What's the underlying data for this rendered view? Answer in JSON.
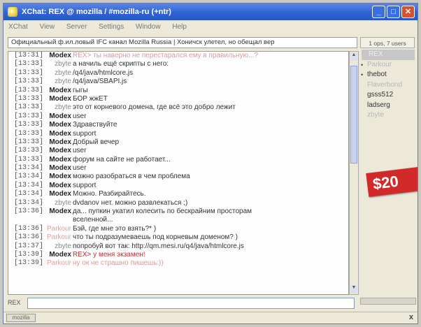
{
  "window": {
    "title": "XChat: REX @ mozilla / #mozilla-ru (+ntr)",
    "menu": [
      "XChat",
      "View",
      "Server",
      "Settings",
      "Window",
      "Help"
    ]
  },
  "channel_topic": "Официальный ф.ил.ловый IFC канал Mozilla Russia | Хоничск улетел, но обещал вер",
  "messages": [
    {
      "time": "[13:31]",
      "nick": "Modex",
      "text": "REX> ты наверно не перестарался ему в правильную...?",
      "style": "modex",
      "msg_style": "faded"
    },
    {
      "time": "[13:33]",
      "nick": "zbyte",
      "text": "а начиль ещё скрипты с него:",
      "style": "",
      "msg_style": ""
    },
    {
      "time": "[13:33]",
      "nick": "zbyte",
      "text": "/q4/java/htmlcore.js",
      "style": "",
      "msg_style": ""
    },
    {
      "time": "[13:33]",
      "nick": "zbyte",
      "text": "/q4/java/SBAPI.js",
      "style": "",
      "msg_style": ""
    },
    {
      "time": "[13:33]",
      "nick": "Modex",
      "text": "гыгы",
      "style": "modex",
      "msg_style": ""
    },
    {
      "time": "[13:33]",
      "nick": "Modex",
      "text": "БОР жжЕТ",
      "style": "modex",
      "msg_style": ""
    },
    {
      "time": "[13:33]",
      "nick": "zbyte",
      "text": "это от корневого домена, где всё это добро лежит",
      "style": "",
      "msg_style": ""
    },
    {
      "time": "[13:33]",
      "nick": "Modex",
      "text": "user",
      "style": "modex",
      "msg_style": ""
    },
    {
      "time": "[13:33]",
      "nick": "Modex",
      "text": "Здравствуйте",
      "style": "modex",
      "msg_style": ""
    },
    {
      "time": "[13:33]",
      "nick": "Modex",
      "text": "support",
      "style": "modex",
      "msg_style": ""
    },
    {
      "time": "[13:33]",
      "nick": "Modex",
      "text": "Добрый вечер",
      "style": "modex",
      "msg_style": ""
    },
    {
      "time": "[13:33]",
      "nick": "Modex",
      "text": "user",
      "style": "modex",
      "msg_style": ""
    },
    {
      "time": "[13:33]",
      "nick": "Modex",
      "text": "форум на сайте не работает...",
      "style": "modex",
      "msg_style": ""
    },
    {
      "time": "[13:34]",
      "nick": "Modex",
      "text": "user",
      "style": "modex",
      "msg_style": ""
    },
    {
      "time": "[13:34]",
      "nick": "Modex",
      "text": "можно разобраться в чем проблема",
      "style": "modex",
      "msg_style": ""
    },
    {
      "time": "[13:34]",
      "nick": "Modex",
      "text": "support",
      "style": "modex",
      "msg_style": ""
    },
    {
      "time": "[13:34]",
      "nick": "Modex",
      "text": "Можно. Разбирайтесь.",
      "style": "modex",
      "msg_style": ""
    },
    {
      "time": "[13:34]",
      "nick": "zbyte",
      "text": "dvdanov нет. можно развлекаться ;)",
      "style": "",
      "msg_style": ""
    },
    {
      "time": "[13:36]",
      "nick": "Modex",
      "text": "да... пупкин укатил колесить по бескрайним просторам",
      "style": "modex",
      "msg_style": ""
    },
    {
      "time": "",
      "nick": "",
      "text": "вселенной...",
      "style": "",
      "msg_style": ""
    },
    {
      "time": "[13:36]",
      "nick": "Parkour",
      "text": "Бэй, где мне это взять?* )",
      "style": "faded",
      "msg_style": ""
    },
    {
      "time": "[13:36]",
      "nick": "Parkour",
      "text": "что ты подразумеваешь под корневым доменом? )",
      "style": "faded",
      "msg_style": ""
    },
    {
      "time": "[13:37]",
      "nick": "zbyte",
      "text": "попробуй вот так: http://qm.mesi.ru/q4/java/htmlcore.js",
      "style": "",
      "msg_style": ""
    },
    {
      "time": "[13:39]",
      "nick": "Modex",
      "text": "REX> у меня экзамен!",
      "style": "modex",
      "msg_style": "hl"
    },
    {
      "time": "[13:39]",
      "nick": "Parkour",
      "text": "ну ок не страшно пишешь:))",
      "style": "faded",
      "msg_style": "faded"
    }
  ],
  "userlist": {
    "header": "1 ops, 7 users",
    "users": [
      {
        "name": "REX",
        "style": "sel",
        "mark": ""
      },
      {
        "name": "Parkour",
        "style": "faded",
        "mark": "•"
      },
      {
        "name": "thebot",
        "style": "",
        "mark": "•"
      },
      {
        "name": "Flaverbond",
        "style": "faded",
        "mark": ""
      },
      {
        "name": "gsss512",
        "style": "",
        "mark": ""
      },
      {
        "name": "ladserg",
        "style": "",
        "mark": ""
      },
      {
        "name": "zbyte",
        "style": "faded",
        "mark": ""
      }
    ]
  },
  "ad_text": "$20",
  "input": {
    "nick": "REX",
    "value": ""
  },
  "statusbar": {
    "tab_label": "mozilla",
    "close_glyph": "x"
  },
  "colors": {
    "titlebar": "#2f63d4",
    "modex_nick": "#222222",
    "highlight": "#c03030",
    "ad": "#d22a2a"
  }
}
